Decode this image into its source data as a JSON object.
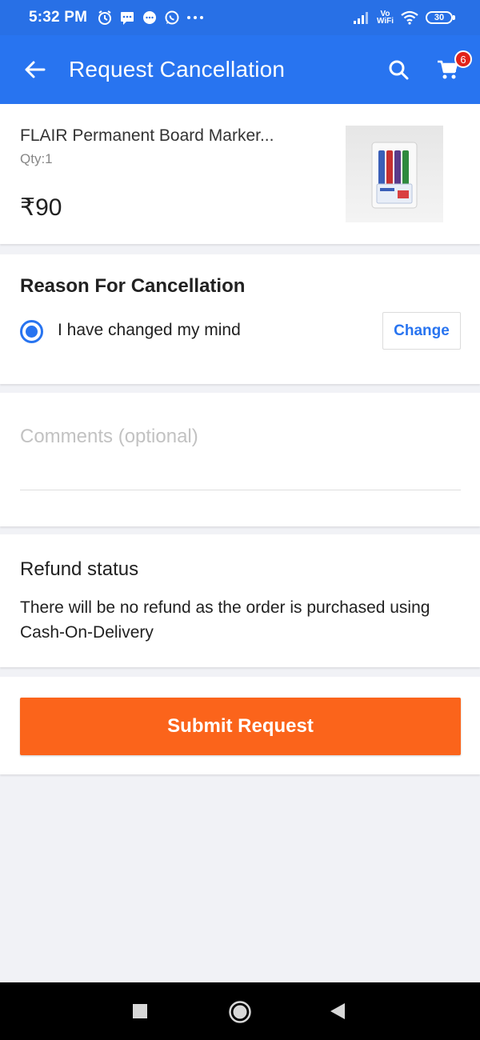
{
  "status_bar": {
    "time": "5:32 PM",
    "vowifi_top": "Vo",
    "vowifi_bottom": "WiFi",
    "battery": "30"
  },
  "app_bar": {
    "title": "Request Cancellation",
    "cart_count": "6",
    "accent": "#2874f0"
  },
  "product": {
    "name": "FLAIR Permanent Board Marker...",
    "qty": "Qty:1",
    "price": "₹90"
  },
  "reason": {
    "title": "Reason For Cancellation",
    "selected": "I have changed my mind",
    "change_label": "Change"
  },
  "comments": {
    "placeholder": "Comments (optional)",
    "value": ""
  },
  "refund": {
    "title": "Refund status",
    "text": "There will be no refund as the order is purchased using Cash-On-Delivery"
  },
  "submit": {
    "label": "Submit Request",
    "color": "#fb641b"
  }
}
